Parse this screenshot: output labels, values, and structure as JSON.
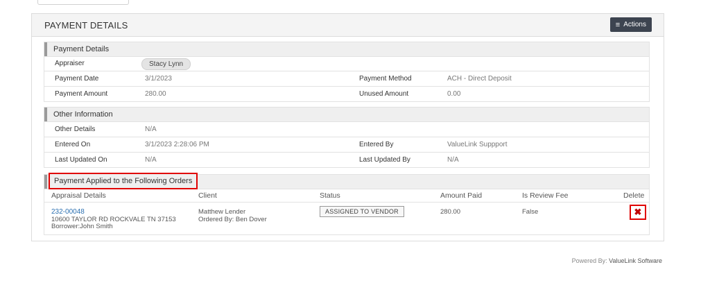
{
  "panel": {
    "title": "PAYMENT DETAILS",
    "actions_label": "Actions"
  },
  "payment_details": {
    "heading": "Payment Details",
    "appraiser_label": "Appraiser",
    "appraiser_value": "Stacy Lynn",
    "payment_date_label": "Payment Date",
    "payment_date_value": "3/1/2023",
    "payment_method_label": "Payment Method",
    "payment_method_value": "ACH - Direct Deposit",
    "payment_amount_label": "Payment Amount",
    "payment_amount_value": "280.00",
    "unused_amount_label": "Unused Amount",
    "unused_amount_value": "0.00"
  },
  "other_info": {
    "heading": "Other Information",
    "other_details_label": "Other Details",
    "other_details_value": "N/A",
    "entered_on_label": "Entered On",
    "entered_on_value": "3/1/2023 2:28:06 PM",
    "entered_by_label": "Entered By",
    "entered_by_value": "ValueLink Suppport",
    "last_updated_on_label": "Last Updated On",
    "last_updated_on_value": "N/A",
    "last_updated_by_label": "Last Updated By",
    "last_updated_by_value": "N/A"
  },
  "orders": {
    "heading": "Payment Applied to the Following Orders",
    "columns": [
      "Appraisal Details",
      "Client",
      "Status",
      "Amount Paid",
      "Is Review Fee",
      "Delete"
    ],
    "rows": [
      {
        "order_id": "232-00048",
        "address": "10600 TAYLOR RD ROCKVALE TN 37153",
        "borrower": "Borrower:John Smith",
        "client": "Matthew Lender",
        "ordered_by": "Ordered By: Ben Dover",
        "status": "ASSIGNED TO VENDOR",
        "amount_paid": "280.00",
        "is_review_fee": "False",
        "delete_icon": "close-x-icon"
      }
    ]
  },
  "footer": {
    "prefix": "Powered By:",
    "brand": "ValueLink Software"
  },
  "colors": {
    "highlight": "#e00000",
    "link": "#2a6fb0",
    "button": "#3d4450"
  }
}
